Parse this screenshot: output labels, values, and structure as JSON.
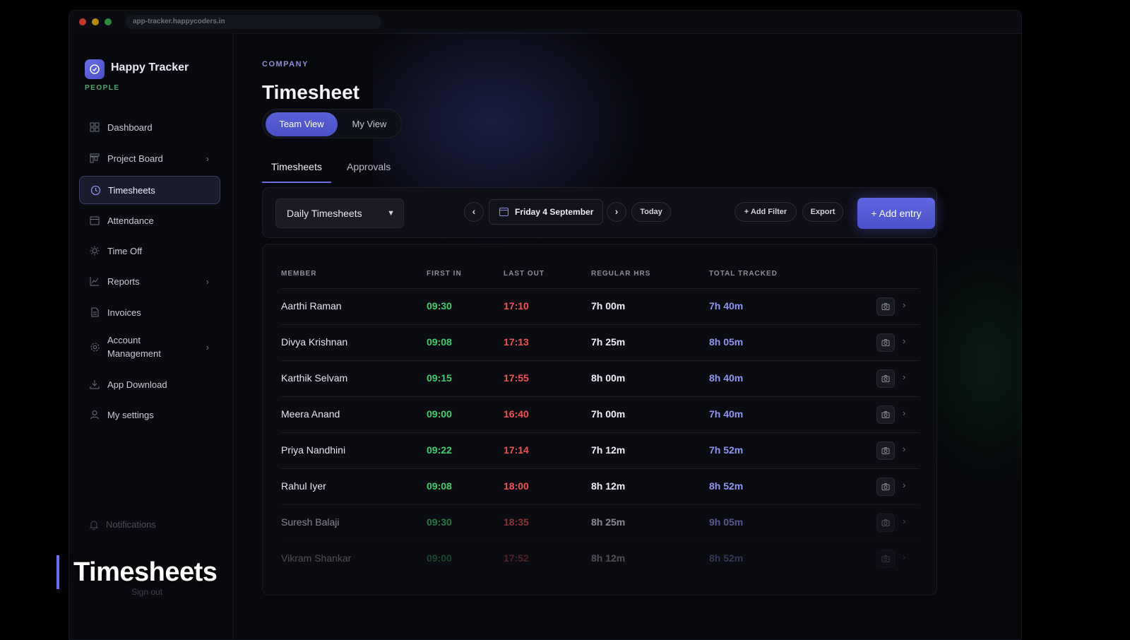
{
  "browser": {
    "url": "app-tracker.happycoders.in"
  },
  "brand": {
    "name": "Happy Tracker",
    "subtitle": "PEOPLE",
    "icon": "clock-icon"
  },
  "sidebar": {
    "items": [
      {
        "label": "Dashboard",
        "icon": "grid-icon",
        "has_chevron": false,
        "active": false
      },
      {
        "label": "Project Board",
        "icon": "board-icon",
        "has_chevron": true,
        "active": false
      },
      {
        "label": "Timesheets",
        "icon": "clock-icon",
        "has_chevron": false,
        "active": true
      },
      {
        "label": "Attendance",
        "icon": "calendar-icon",
        "has_chevron": false,
        "active": false
      },
      {
        "label": "Time Off",
        "icon": "sun-icon",
        "has_chevron": false,
        "active": false
      },
      {
        "label": "Reports",
        "icon": "chart-icon",
        "has_chevron": true,
        "active": false
      },
      {
        "label": "Invoices",
        "icon": "document-icon",
        "has_chevron": false,
        "active": false
      },
      {
        "label": "Account Management",
        "icon": "gear-icon",
        "has_chevron": true,
        "active": false
      },
      {
        "label": "App Download",
        "icon": "download-icon",
        "has_chevron": false,
        "active": false
      },
      {
        "label": "My settings",
        "icon": "user-icon",
        "has_chevron": false,
        "active": false
      }
    ],
    "notifications_label": "Notifications",
    "signout_label": "Sign out"
  },
  "header": {
    "eyebrow": "COMPANY",
    "title": "Timesheet",
    "view_toggle": {
      "active": "Team View",
      "inactive": "My View"
    },
    "tabs": [
      {
        "label": "Timesheets",
        "active": true
      },
      {
        "label": "Approvals",
        "active": false
      }
    ]
  },
  "toolbar": {
    "select_value": "Daily Timesheets",
    "prev_label": "‹",
    "date_label": "Friday 4 September",
    "next_label": "›",
    "today_label": "Today",
    "add_filter_label": "+ Add Filter",
    "export_label": "Export",
    "add_entry_label": "+ Add entry"
  },
  "table": {
    "columns": [
      "MEMBER",
      "FIRST IN",
      "LAST OUT",
      "REGULAR HRS",
      "TOTAL TRACKED"
    ],
    "rows": [
      {
        "member": "Aarthi Raman",
        "first_in": "09:30",
        "last_out": "17:10",
        "regular": "7h 00m",
        "total": "7h 40m"
      },
      {
        "member": "Divya Krishnan",
        "first_in": "09:08",
        "last_out": "17:13",
        "regular": "7h 25m",
        "total": "8h 05m"
      },
      {
        "member": "Karthik Selvam",
        "first_in": "09:15",
        "last_out": "17:55",
        "regular": "8h 00m",
        "total": "8h 40m"
      },
      {
        "member": "Meera Anand",
        "first_in": "09:00",
        "last_out": "16:40",
        "regular": "7h 00m",
        "total": "7h 40m"
      },
      {
        "member": "Priya Nandhini",
        "first_in": "09:22",
        "last_out": "17:14",
        "regular": "7h 12m",
        "total": "7h 52m"
      },
      {
        "member": "Rahul Iyer",
        "first_in": "09:08",
        "last_out": "18:00",
        "regular": "8h 12m",
        "total": "8h 52m"
      },
      {
        "member": "Suresh Balaji",
        "first_in": "09:30",
        "last_out": "18:35",
        "regular": "8h 25m",
        "total": "9h 05m"
      },
      {
        "member": "Vikram Shankar",
        "first_in": "09:00",
        "last_out": "17:52",
        "regular": "8h 12m",
        "total": "8h 52m"
      }
    ]
  },
  "caption": "Timesheets",
  "colors": {
    "accent": "#5f66e0",
    "first_in": "#3fce6d",
    "last_out": "#ef5454",
    "total": "#9096f2",
    "brand_sub": "#4fa86d"
  }
}
